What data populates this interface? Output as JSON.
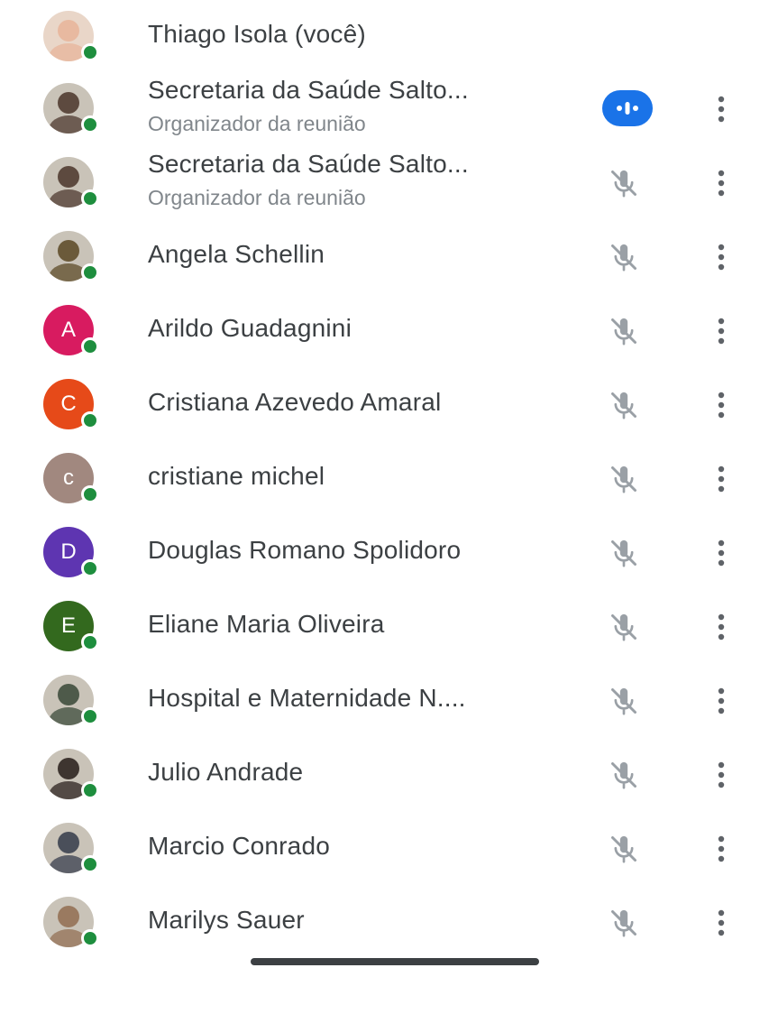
{
  "participants": [
    {
      "name": "Thiago Isola (você)",
      "subtitle": "",
      "avatar_type": "photo",
      "avatar_letter": "",
      "avatar_color": "#e8b9a0",
      "mic": "none"
    },
    {
      "name": "Secretaria da Saúde Salto...",
      "subtitle": "Organizador da reunião",
      "avatar_type": "photo",
      "avatar_letter": "",
      "avatar_color": "#5d4a3f",
      "mic": "speaking"
    },
    {
      "name": "Secretaria da Saúde Salto...",
      "subtitle": "Organizador da reunião",
      "avatar_type": "photo",
      "avatar_letter": "",
      "avatar_color": "#5d4a3f",
      "mic": "muted"
    },
    {
      "name": "Angela Schellin",
      "subtitle": "",
      "avatar_type": "photo",
      "avatar_letter": "",
      "avatar_color": "#6b5a3a",
      "mic": "muted"
    },
    {
      "name": "Arildo Guadagnini",
      "subtitle": "",
      "avatar_type": "letter",
      "avatar_letter": "A",
      "avatar_color": "#d81b60",
      "mic": "muted"
    },
    {
      "name": "Cristiana Azevedo Amaral",
      "subtitle": "",
      "avatar_type": "letter",
      "avatar_letter": "C",
      "avatar_color": "#e64a19",
      "mic": "muted"
    },
    {
      "name": "cristiane michel",
      "subtitle": "",
      "avatar_type": "letter",
      "avatar_letter": "c",
      "avatar_color": "#a1887f",
      "mic": "muted"
    },
    {
      "name": "Douglas Romano Spolidoro",
      "subtitle": "",
      "avatar_type": "letter",
      "avatar_letter": "D",
      "avatar_color": "#5e35b1",
      "mic": "muted"
    },
    {
      "name": "Eliane Maria Oliveira",
      "subtitle": "",
      "avatar_type": "letter",
      "avatar_letter": "E",
      "avatar_color": "#33691e",
      "mic": "muted"
    },
    {
      "name": "Hospital e Maternidade N....",
      "subtitle": "",
      "avatar_type": "photo",
      "avatar_letter": "",
      "avatar_color": "#4e5a4a",
      "mic": "muted"
    },
    {
      "name": "Julio Andrade",
      "subtitle": "",
      "avatar_type": "photo",
      "avatar_letter": "",
      "avatar_color": "#3e3530",
      "mic": "muted"
    },
    {
      "name": "Marcio Conrado",
      "subtitle": "",
      "avatar_type": "photo",
      "avatar_letter": "",
      "avatar_color": "#4a4f5a",
      "mic": "muted"
    },
    {
      "name": "Marilys Sauer",
      "subtitle": "",
      "avatar_type": "photo",
      "avatar_letter": "",
      "avatar_color": "#9a7a60",
      "mic": "muted"
    }
  ],
  "colors": {
    "presence": "#1e8e3e",
    "speaking": "#1a73e8",
    "text_primary": "#3c4043",
    "text_secondary": "#80868b",
    "icon": "#5f6368"
  },
  "icons": {
    "muted": "mic-off-icon",
    "speaking": "audio-level-icon",
    "more": "more-vert-icon",
    "presence": "presence-dot-icon"
  }
}
